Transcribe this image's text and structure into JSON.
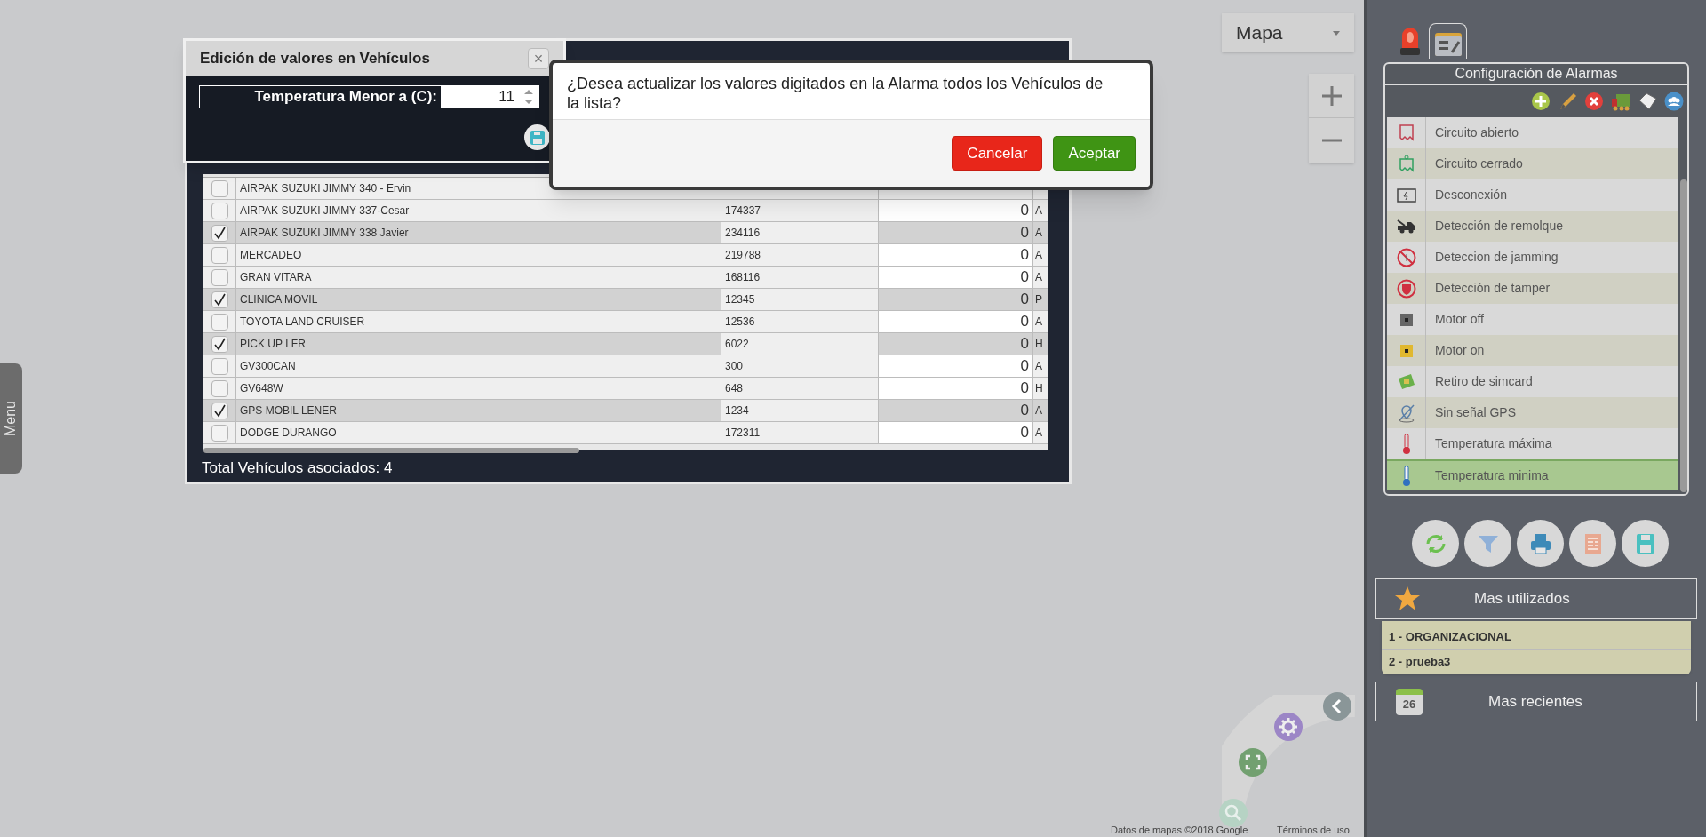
{
  "map": {
    "type_select": "Mapa",
    "menu_tab": "Menu",
    "attribution": "Datos de mapas ©2018 Google",
    "terms_link": "Términos de uso"
  },
  "vehicles_window": {
    "total": "Total Vehículos asociados: 4",
    "rows": [
      {
        "checked": false,
        "name": "AIRPAK SUZUKI JIMMY 340 - Ervin"
      },
      {
        "checked": false,
        "name": "AIRPAK SUZUKI JIMMY 337-Cesar",
        "code": "174337",
        "value": "0",
        "column_4": "A"
      },
      {
        "checked": true,
        "name": "AIRPAK SUZUKI JIMMY 338 Javier",
        "code": "234116",
        "value": "0",
        "column_4": "A"
      },
      {
        "checked": false,
        "name": "MERCADEO",
        "code": "219788",
        "value": "0",
        "column_4": "A"
      },
      {
        "checked": false,
        "name": "GRAN VITARA",
        "code": "168116",
        "value": "0",
        "column_4": "A"
      },
      {
        "checked": true,
        "name": "CLINICA MOVIL",
        "code": "12345",
        "value": "0",
        "column_4": "P"
      },
      {
        "checked": false,
        "name": "TOYOTA LAND CRUISER",
        "code": "12536",
        "value": "0",
        "column_4": "A"
      },
      {
        "checked": true,
        "name": "PICK UP LFR",
        "code": "6022",
        "value": "0",
        "column_4": "H"
      },
      {
        "checked": false,
        "name": "GV300CAN",
        "code": "300",
        "value": "0",
        "column_4": "A"
      },
      {
        "checked": false,
        "name": "GV648W",
        "code": "648",
        "value": "0",
        "column_4": "H"
      },
      {
        "checked": true,
        "name": "GPS MOBIL LENER",
        "code": "1234",
        "value": "0",
        "column_4": "A"
      },
      {
        "checked": false,
        "name": "DODGE DURANGO",
        "code": "172311",
        "value": "0",
        "column_4": "A"
      }
    ]
  },
  "edit_dialog": {
    "title": "Edición de valores en Vehículos",
    "close": "×",
    "field_label": "Temperatura Menor a (C):",
    "field_value": "11"
  },
  "confirm_dialog": {
    "message": "¿Desea actualizar los valores digitados en la Alarma todos los Vehículos de la lista?",
    "buttons": [
      {
        "label": "Cancelar",
        "kind": "cancel"
      },
      {
        "label": "Aceptar",
        "kind": "accept"
      }
    ]
  },
  "alarm_panel": {
    "tabs": [
      {
        "kind": "siren",
        "selected": false
      },
      {
        "kind": "config",
        "selected": true
      }
    ],
    "title": "Configuración de Alarmas",
    "items": [
      {
        "label": "Circuito abierto",
        "kind": "circuit-open",
        "selected": false
      },
      {
        "label": "Circuito cerrado",
        "kind": "circuit-closed",
        "selected": false
      },
      {
        "label": "Desconexión",
        "kind": "battery",
        "selected": false
      },
      {
        "label": "Detección de remolque",
        "kind": "tow",
        "selected": false
      },
      {
        "label": "Deteccion de jamming",
        "kind": "jamming",
        "selected": false
      },
      {
        "label": "Detección de tamper",
        "kind": "tamper",
        "selected": false
      },
      {
        "label": "Motor off",
        "kind": "motor-off",
        "selected": false
      },
      {
        "label": "Motor on",
        "kind": "motor-on",
        "selected": false
      },
      {
        "label": "Retiro de simcard",
        "kind": "sim",
        "selected": false
      },
      {
        "label": "Sin señal GPS",
        "kind": "gps",
        "selected": false
      },
      {
        "label": "Temperatura máxima",
        "kind": "temp-max",
        "selected": false
      },
      {
        "label": "Temperatura minima",
        "kind": "temp-min",
        "selected": true
      }
    ]
  },
  "most_used": {
    "title": "Mas utilizados",
    "items": [
      "1 - ORGANIZACIONAL",
      "2 - prueba3"
    ]
  },
  "recent": {
    "title": "Mas recientes",
    "calendar_day": "26"
  }
}
